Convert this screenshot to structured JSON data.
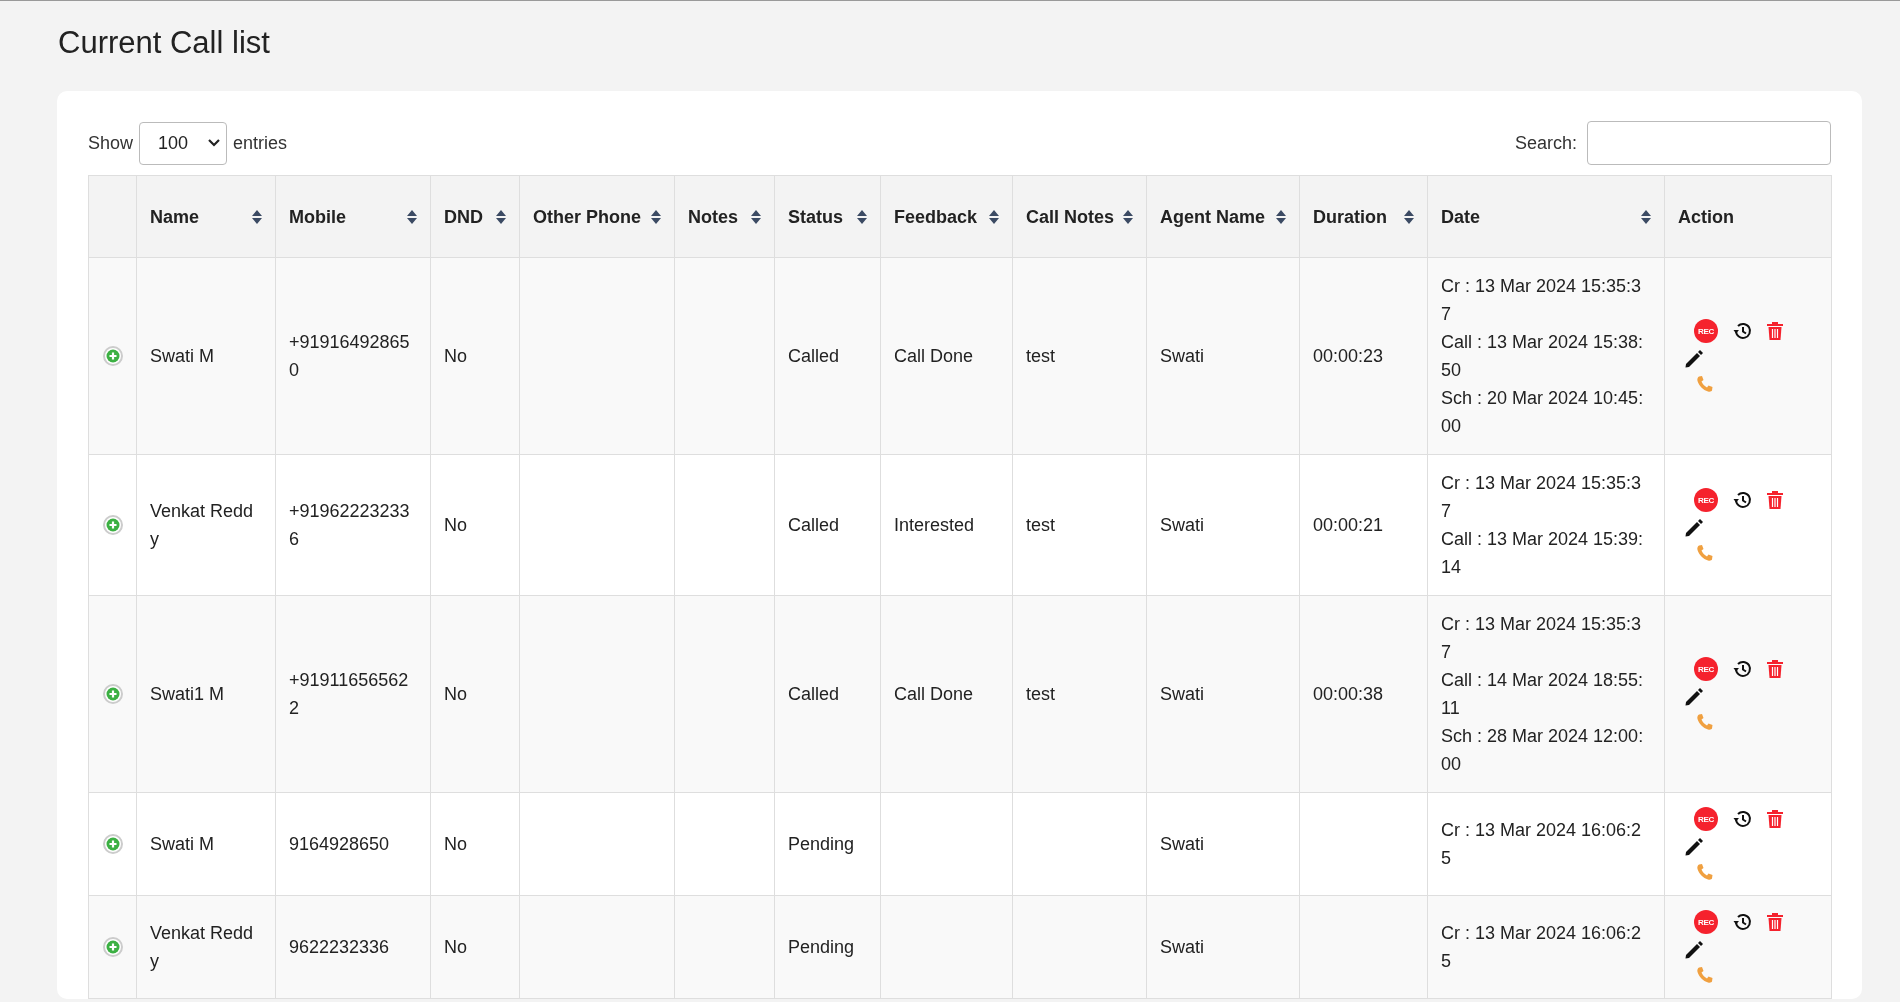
{
  "page_title": "Current Call list",
  "length_control": {
    "prefix": "Show",
    "value": "100",
    "suffix": "entries"
  },
  "search": {
    "label": "Search:"
  },
  "columns": [
    {
      "label": "Name",
      "sortable": true
    },
    {
      "label": "Mobile",
      "sortable": true
    },
    {
      "label": "DND",
      "sortable": true
    },
    {
      "label": "Other Phone",
      "sortable": true
    },
    {
      "label": "Notes",
      "sortable": true
    },
    {
      "label": "Status",
      "sortable": true
    },
    {
      "label": "Feedback",
      "sortable": true
    },
    {
      "label": "Call Notes",
      "sortable": true
    },
    {
      "label": "Agent Name",
      "sortable": true
    },
    {
      "label": "Duration",
      "sortable": true
    },
    {
      "label": "Date",
      "sortable": true
    },
    {
      "label": "Action",
      "sortable": false
    }
  ],
  "rows": [
    {
      "name": "Swati M",
      "mobile": "+919164928650",
      "dnd": "No",
      "status": "Called",
      "feedback": "Call Done",
      "call_notes": "test",
      "agent_name": "Swati",
      "duration": "00:00:23",
      "date_lines": [
        "Cr : 13 Mar 2024 15:35:37",
        "Call : 13 Mar 2024 15:38:50",
        "Sch : 20 Mar 2024 10:45:00"
      ],
      "rec_label": "REC"
    },
    {
      "name": "Venkat Reddy",
      "mobile": "+919622232336",
      "dnd": "No",
      "status": "Called",
      "feedback": "Interested",
      "call_notes": "test",
      "agent_name": "Swati",
      "duration": "00:00:21",
      "date_lines": [
        "Cr : 13 Mar 2024 15:35:37",
        "Call : 13 Mar 2024 15:39:14"
      ],
      "rec_label": "REC"
    },
    {
      "name": "Swati1 M",
      "mobile": "+919116565622",
      "dnd": "No",
      "status": "Called",
      "feedback": "Call Done",
      "call_notes": "test",
      "agent_name": "Swati",
      "duration": "00:00:38",
      "date_lines": [
        "Cr : 13 Mar 2024 15:35:37",
        "Call : 14 Mar 2024 18:55:11",
        "Sch : 28 Mar 2024 12:00:00"
      ],
      "rec_label": "REC"
    },
    {
      "name": "Swati M",
      "mobile": "9164928650",
      "dnd": "No",
      "status": "Pending",
      "agent_name": "Swati",
      "date_lines": [
        "Cr : 13 Mar 2024 16:06:25"
      ],
      "rec_label": "REC"
    },
    {
      "name": "Venkat Reddy",
      "mobile": "9622232336",
      "dnd": "No",
      "status": "Pending",
      "agent_name": "Swati",
      "date_lines": [
        "Cr : 13 Mar 2024 16:06:25"
      ],
      "rec_label": "REC"
    }
  ]
}
